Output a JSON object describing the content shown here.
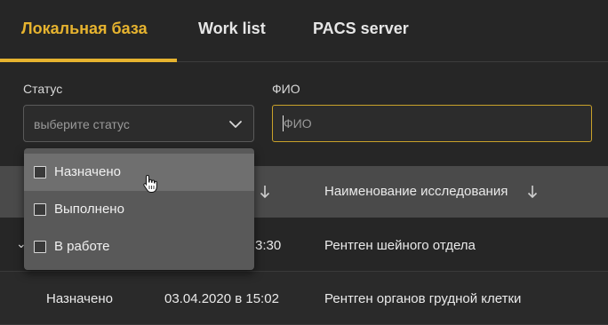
{
  "tabs": [
    {
      "label": "Локальная база",
      "active": true
    },
    {
      "label": "Work list",
      "active": false
    },
    {
      "label": "PACS server",
      "active": false
    }
  ],
  "filters": {
    "status_label": "Статус",
    "status_placeholder": "выберите статус",
    "fio_label": "ФИО",
    "fio_placeholder": "ФИО",
    "fio_value": ""
  },
  "status_options": [
    {
      "label": "Назначено",
      "checked": false
    },
    {
      "label": "Выполнено",
      "checked": false
    },
    {
      "label": "В работе",
      "checked": false
    }
  ],
  "table": {
    "headers": {
      "study_name": "Наименование исследования"
    },
    "rows": [
      {
        "status": "",
        "date": "3:30",
        "study": "Рентген шейного отдела"
      },
      {
        "status": "Назначено",
        "date": "03.04.2020 в 15:02",
        "study": "Рентген органов грудной клетки"
      }
    ]
  },
  "colors": {
    "accent": "#e6b32f",
    "background": "#262626",
    "header_bg": "#4a4a4a",
    "dropdown_bg": "#595959"
  },
  "icons": [
    "chevron-down-icon",
    "sort-arrow-icon",
    "checkbox-icon",
    "hand-pointer-icon"
  ]
}
